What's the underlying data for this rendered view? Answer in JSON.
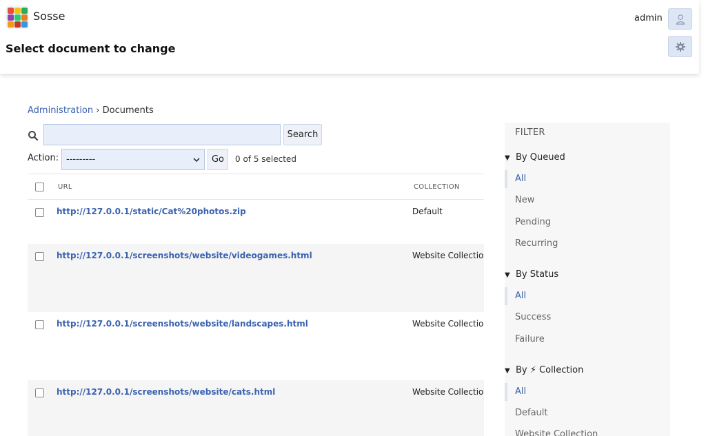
{
  "app": {
    "name": "Sosse",
    "page_title": "Select document to change",
    "user": "admin"
  },
  "breadcrumb": {
    "root": "Administration",
    "separator": "›",
    "current": "Documents"
  },
  "search": {
    "value": "",
    "placeholder": "",
    "button": "Search"
  },
  "action": {
    "label": "Action:",
    "selected_value": "---------",
    "go": "Go",
    "selected_count": "0 of 5 selected"
  },
  "table": {
    "columns": [
      "URL",
      "COLLECTION"
    ],
    "rows": [
      {
        "url": "http://127.0.0.1/static/Cat%20photos.zip",
        "collection": "Default"
      },
      {
        "url": "http://127.0.0.1/screenshots/website/videogames.html",
        "collection": "Website Collection"
      },
      {
        "url": "http://127.0.0.1/screenshots/website/landscapes.html",
        "collection": "Website Collection"
      },
      {
        "url": "http://127.0.0.1/screenshots/website/cats.html",
        "collection": "Website Collection"
      }
    ]
  },
  "filter": {
    "title": "FILTER",
    "groups": [
      {
        "title": "By Queued",
        "items": [
          "All",
          "New",
          "Pending",
          "Recurring"
        ],
        "selected": "All"
      },
      {
        "title": "By Status",
        "items": [
          "All",
          "Success",
          "Failure"
        ],
        "selected": "All"
      },
      {
        "title": "By ⚡ Collection",
        "items": [
          "All",
          "Default",
          "Website Collection"
        ],
        "selected": "All"
      }
    ]
  },
  "icons": {
    "logo": "sosse-logo-icon",
    "user": "user-icon",
    "settings": "gear-icon",
    "search": "search-icon",
    "expand": "triangle-down-icon"
  },
  "colors": {
    "link": "#3a63b0",
    "input_bg": "#e8effa",
    "header_button_bg": "#dde6f5",
    "filter_bg": "#f7f7f7"
  }
}
